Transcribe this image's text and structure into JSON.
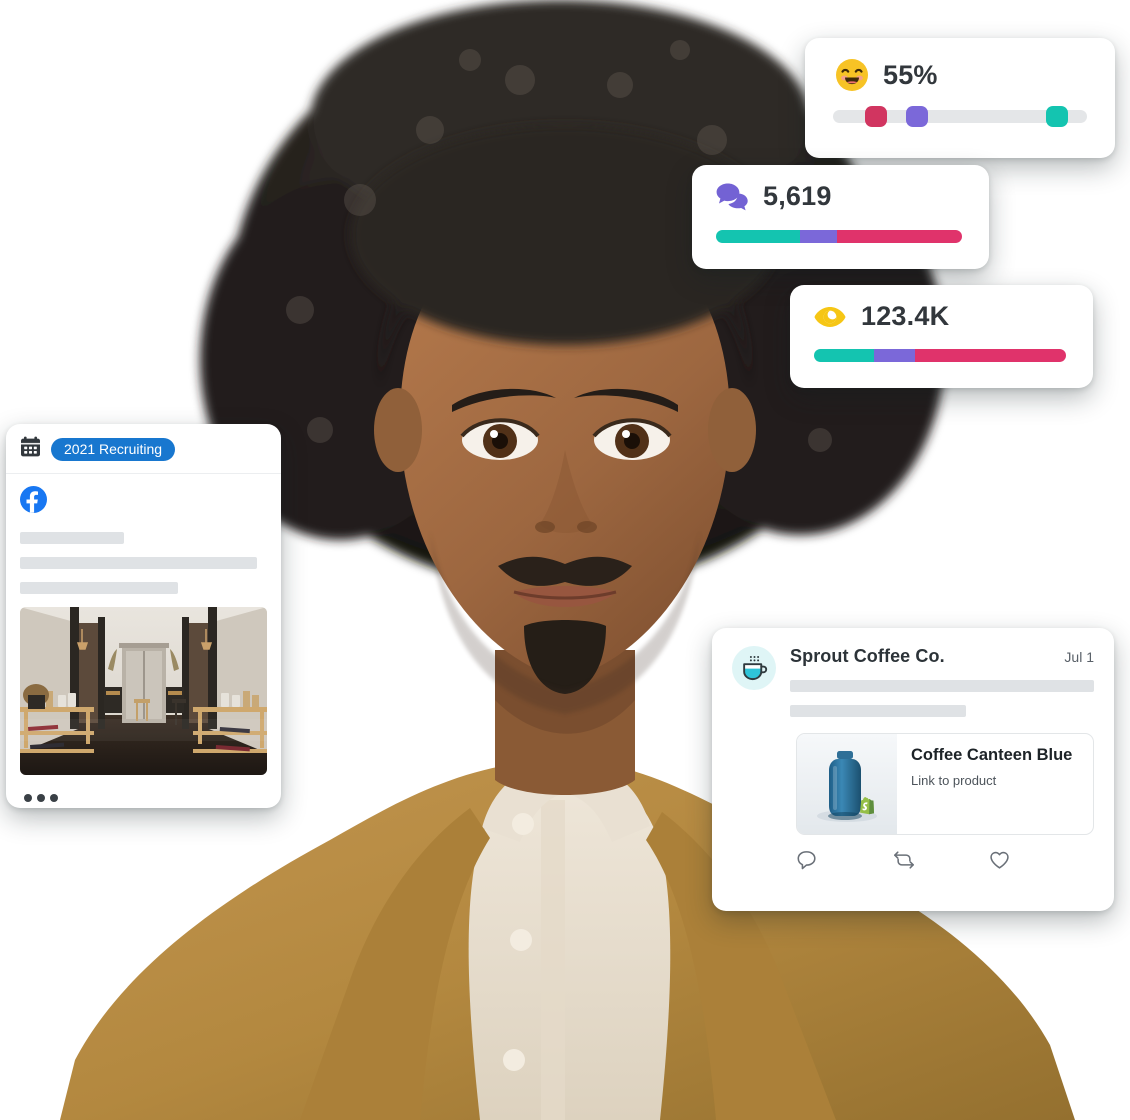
{
  "page": {
    "title": "Social media analytics hero",
    "background": "#ffffff"
  },
  "colors": {
    "teal": "#14c4b0",
    "purple": "#7b68d9",
    "pink": "#e0336b",
    "pink_knob": "#d13560",
    "yellow": "#f6c615",
    "emoji_yellow": "#f7c325",
    "facebook_blue": "#1877f2",
    "pill_blue": "#1877cf",
    "track_gray": "#e4e6e8",
    "placeholder_gray": "#dfe2e5",
    "text_dark": "#32373c",
    "shopify_green": "#7cb342",
    "avatar_bg": "#dff5f6",
    "bottle_blue": "#2a6f9e"
  },
  "portrait": {
    "alt": "Smiling man with afro hair wearing a tan blazer over a cream henley shirt",
    "skin": "#9a6a43",
    "hair": "#2a2623",
    "jacket": "#b78b4c",
    "shirt": "#e8ded0"
  },
  "cards": {
    "sentiment": {
      "name": "sentiment-card",
      "icon": "smiling-face-emoji",
      "value": "55%",
      "slider": {
        "type": "multi-thumb-slider",
        "track_color": "#e4e6e8",
        "thumbs": [
          {
            "name": "pink-thumb",
            "position_pct": 17,
            "color": "#d13560"
          },
          {
            "name": "purple-thumb",
            "position_pct": 33,
            "color": "#7b68d9"
          },
          {
            "name": "teal-thumb",
            "position_pct": 88,
            "color": "#14c4b0"
          }
        ]
      }
    },
    "messages": {
      "name": "messages-card",
      "icon": "chat-bubbles-icon",
      "value": "5,619",
      "bar": {
        "type": "stacked-bar",
        "segments": [
          {
            "name": "teal-segment",
            "pct": 34,
            "color": "#14c4b0"
          },
          {
            "name": "purple-segment",
            "pct": 15,
            "color": "#7b68d9"
          },
          {
            "name": "pink-segment",
            "pct": 51,
            "color": "#e0336b"
          }
        ]
      }
    },
    "impressions": {
      "name": "impressions-card",
      "icon": "eye-icon",
      "value": "123.4K",
      "bar": {
        "type": "stacked-bar",
        "segments": [
          {
            "name": "teal-segment",
            "pct": 24,
            "color": "#14c4b0"
          },
          {
            "name": "purple-segment",
            "pct": 16,
            "color": "#7b68d9"
          },
          {
            "name": "pink-segment",
            "pct": 60,
            "color": "#e0336b"
          }
        ]
      }
    },
    "post": {
      "name": "scheduled-post-card",
      "calendar_icon": "calendar-icon",
      "tag_label": "2021 Recruiting",
      "network_icon": "facebook-icon",
      "placeholder_widths": [
        "42%",
        "96%",
        "64%"
      ],
      "photo_alt": "Interior of a modern cafe with wooden display shelves and an elevator at the end",
      "more_icon": "more-options-icon"
    },
    "tweet": {
      "name": "social-post-preview-card",
      "avatar_icon": "coffee-cup-icon",
      "author": "Sprout Coffee Co.",
      "date": "Jul 1",
      "placeholder_widths": [
        "100%",
        "58%"
      ],
      "product": {
        "image_alt": "Blue insulated water bottle",
        "badge_icon": "shopify-icon",
        "title": "Coffee Canteen Blue",
        "link_label": "Link to product"
      },
      "actions": [
        {
          "name": "reply-icon",
          "label": "Reply"
        },
        {
          "name": "retweet-icon",
          "label": "Retweet"
        },
        {
          "name": "like-icon",
          "label": "Like"
        }
      ]
    }
  }
}
